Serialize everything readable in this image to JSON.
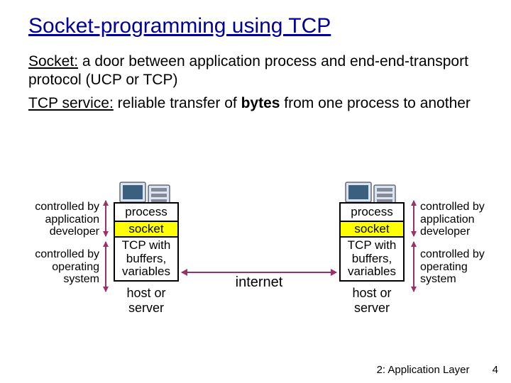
{
  "title": "Socket-programming using TCP",
  "para1": {
    "label": "Socket:",
    "text": " a door between application process and end-end-transport protocol (UCP or TCP)"
  },
  "para2": {
    "label": "TCP service:",
    "pre": " reliable transfer of ",
    "bold": "bytes",
    "post": " from one process to another"
  },
  "labels": {
    "app_dev_left": "controlled by application developer",
    "os_left": "controlled by operating system",
    "app_dev_right": "controlled by application developer",
    "os_right": "controlled by operating system"
  },
  "stack": {
    "process": "process",
    "socket": "socket",
    "tcp": "TCP with buffers, variables",
    "host": "host or server"
  },
  "internet": "internet",
  "footer": {
    "chapter": "2: Application Layer",
    "page": "4"
  }
}
